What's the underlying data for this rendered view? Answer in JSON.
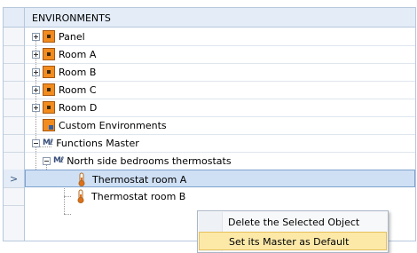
{
  "header": {
    "title": "ENVIRONMENTS"
  },
  "tree": {
    "items": [
      {
        "label": "Panel"
      },
      {
        "label": "Room A"
      },
      {
        "label": "Room B"
      },
      {
        "label": "Room C"
      },
      {
        "label": "Room D"
      },
      {
        "label": "Custom Environments"
      },
      {
        "label": "Functions Master"
      },
      {
        "label": "North side bedrooms thermostats"
      },
      {
        "label": "Thermostat room A"
      },
      {
        "label": "Thermostat room B"
      }
    ]
  },
  "gutter": {
    "arrow": ">"
  },
  "context_menu": {
    "items": [
      {
        "label": "Delete the Selected Object"
      },
      {
        "label": "Set its Master as Default"
      }
    ]
  },
  "colors": {
    "selection": "#cfe0f5",
    "menu_highlight": "#fce9a8",
    "environment_icon": "#f28c1f"
  },
  "icons": {
    "master": "Mℓ"
  }
}
